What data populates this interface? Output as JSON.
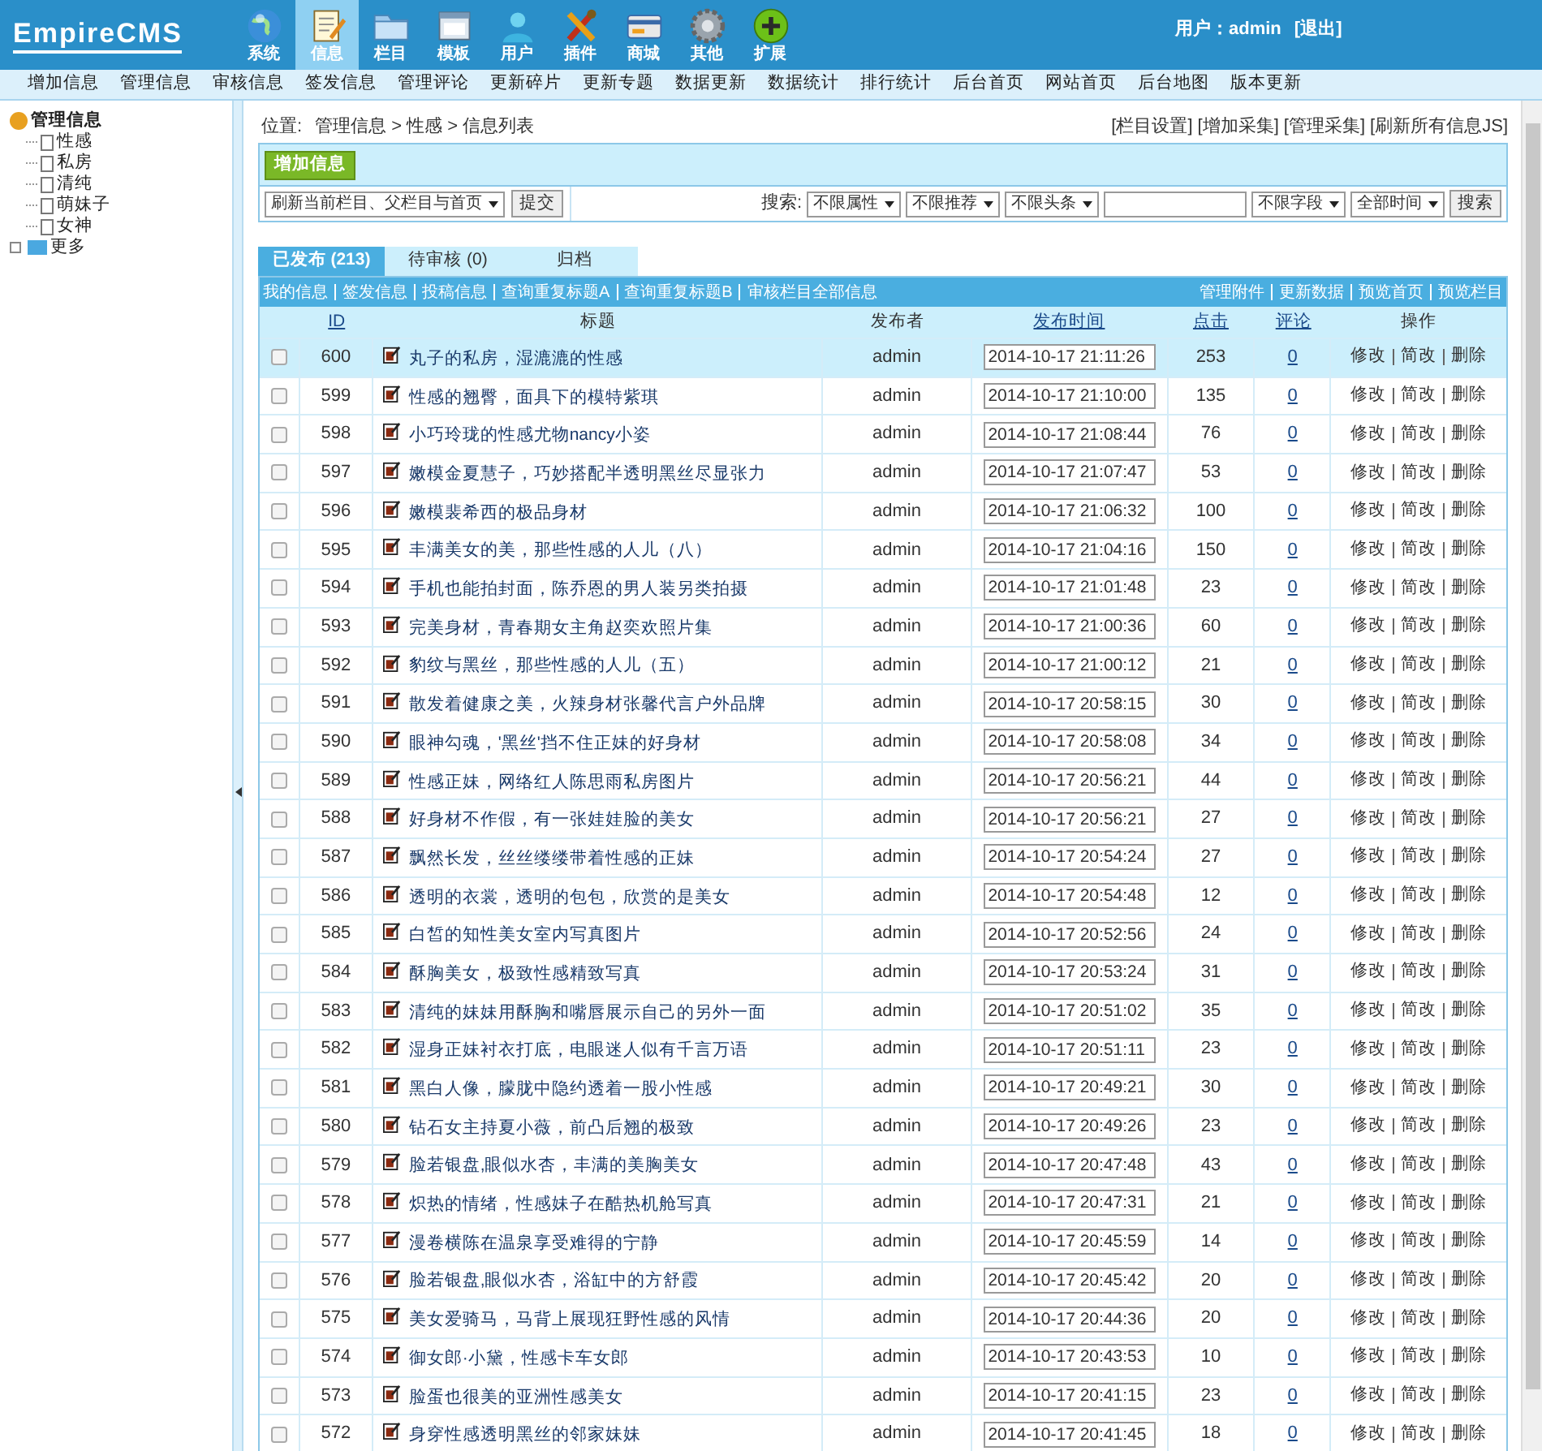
{
  "logo": {
    "text": "EmpireCMS"
  },
  "nav": [
    {
      "label": "系统",
      "selected": false
    },
    {
      "label": "信息",
      "selected": true
    },
    {
      "label": "栏目",
      "selected": false
    },
    {
      "label": "模板",
      "selected": false
    },
    {
      "label": "用户",
      "selected": false
    },
    {
      "label": "插件",
      "selected": false
    },
    {
      "label": "商城",
      "selected": false
    },
    {
      "label": "其他",
      "selected": false
    },
    {
      "label": "扩展",
      "selected": false
    }
  ],
  "user": {
    "label": "用户：",
    "name": "admin",
    "logout": "[退出]"
  },
  "subnav": [
    "增加信息",
    "管理信息",
    "审核信息",
    "签发信息",
    "管理评论",
    "更新碎片",
    "更新专题",
    "数据更新",
    "数据统计",
    "排行统计",
    "后台首页",
    "网站首页",
    "后台地图",
    "版本更新"
  ],
  "sidebar": {
    "tree": [
      {
        "label": "管理信息",
        "expanded": true,
        "children": [
          {
            "label": "性感"
          },
          {
            "label": "私房"
          },
          {
            "label": "清纯"
          },
          {
            "label": "萌妹子"
          },
          {
            "label": "女神"
          }
        ]
      },
      {
        "label": "更多",
        "expanded": false
      }
    ]
  },
  "breadcrumb": {
    "label": "位置:",
    "path": "管理信息 > 性感 > 信息列表"
  },
  "top_links": [
    "[栏目设置]",
    "[增加采集]",
    "[管理采集]",
    "[刷新所有信息JS]"
  ],
  "add_button": "增加信息",
  "refresh": {
    "select": "刷新当前栏目、父栏目与首页",
    "submit": "提交"
  },
  "search": {
    "label": "搜索:",
    "selects_before": [
      "不限属性",
      "不限推荐",
      "不限头条"
    ],
    "selects_after": [
      "不限字段",
      "全部时间"
    ],
    "button": "搜索"
  },
  "tabs": [
    {
      "label": "已发布 (213)",
      "selected": true
    },
    {
      "label": "待审核 (0)",
      "selected": false
    },
    {
      "label": "归档",
      "selected": false
    }
  ],
  "links_left": [
    "我的信息",
    "签发信息",
    "投稿信息",
    "查询重复标题A",
    "查询重复标题B",
    "审核栏目全部信息"
  ],
  "links_right": [
    "管理附件",
    "更新数据",
    "预览首页",
    "预览栏目"
  ],
  "table": {
    "columns": [
      {
        "label": "ID",
        "link": true
      },
      {
        "label": "标题",
        "link": false
      },
      {
        "label": "发布者",
        "link": false
      },
      {
        "label": "发布时间",
        "link": true
      },
      {
        "label": "点击",
        "link": true
      },
      {
        "label": "评论",
        "link": true
      },
      {
        "label": "操作",
        "link": false
      }
    ],
    "rows": [
      {
        "id": "600",
        "title": "丸子的私房，湿漉漉的性感",
        "author": "admin",
        "time": "2014-10-17 21:11:26",
        "clicks": "253",
        "comments": "0",
        "actions": [
          "修改",
          "简改",
          "删除"
        ],
        "selected": true
      },
      {
        "id": "599",
        "title": "性感的翘臀，面具下的模特紫琪",
        "author": "admin",
        "time": "2014-10-17 21:10:00",
        "clicks": "135",
        "comments": "0",
        "actions": [
          "修改",
          "简改",
          "删除"
        ],
        "selected": false
      },
      {
        "id": "598",
        "title": "小巧玲珑的性感尤物nancy小姿",
        "author": "admin",
        "time": "2014-10-17 21:08:44",
        "clicks": "76",
        "comments": "0",
        "actions": [
          "修改",
          "简改",
          "删除"
        ],
        "selected": false
      },
      {
        "id": "597",
        "title": "嫩模金夏慧子，巧妙搭配半透明黑丝尽显张力",
        "author": "admin",
        "time": "2014-10-17 21:07:47",
        "clicks": "53",
        "comments": "0",
        "actions": [
          "修改",
          "简改",
          "删除"
        ],
        "selected": false
      },
      {
        "id": "596",
        "title": "嫩模裴希西的极品身材",
        "author": "admin",
        "time": "2014-10-17 21:06:32",
        "clicks": "100",
        "comments": "0",
        "actions": [
          "修改",
          "简改",
          "删除"
        ],
        "selected": false
      },
      {
        "id": "595",
        "title": "丰满美女的美，那些性感的人儿（八）",
        "author": "admin",
        "time": "2014-10-17 21:04:16",
        "clicks": "150",
        "comments": "0",
        "actions": [
          "修改",
          "简改",
          "删除"
        ],
        "selected": false
      },
      {
        "id": "594",
        "title": "手机也能拍封面，陈乔恩的男人装另类拍摄",
        "author": "admin",
        "time": "2014-10-17 21:01:48",
        "clicks": "23",
        "comments": "0",
        "actions": [
          "修改",
          "简改",
          "删除"
        ],
        "selected": false
      },
      {
        "id": "593",
        "title": "完美身材，青春期女主角赵奕欢照片集",
        "author": "admin",
        "time": "2014-10-17 21:00:36",
        "clicks": "60",
        "comments": "0",
        "actions": [
          "修改",
          "简改",
          "删除"
        ],
        "selected": false
      },
      {
        "id": "592",
        "title": "豹纹与黑丝，那些性感的人儿（五）",
        "author": "admin",
        "time": "2014-10-17 21:00:12",
        "clicks": "21",
        "comments": "0",
        "actions": [
          "修改",
          "简改",
          "删除"
        ],
        "selected": false
      },
      {
        "id": "591",
        "title": "散发着健康之美，火辣身材张馨代言户外品牌",
        "author": "admin",
        "time": "2014-10-17 20:58:15",
        "clicks": "30",
        "comments": "0",
        "actions": [
          "修改",
          "简改",
          "删除"
        ],
        "selected": false
      },
      {
        "id": "590",
        "title": "眼神勾魂，'黑丝'挡不住正妹的好身材",
        "author": "admin",
        "time": "2014-10-17 20:58:08",
        "clicks": "34",
        "comments": "0",
        "actions": [
          "修改",
          "简改",
          "删除"
        ],
        "selected": false
      },
      {
        "id": "589",
        "title": "性感正妹，网络红人陈思雨私房图片",
        "author": "admin",
        "time": "2014-10-17 20:56:21",
        "clicks": "44",
        "comments": "0",
        "actions": [
          "修改",
          "简改",
          "删除"
        ],
        "selected": false
      },
      {
        "id": "588",
        "title": "好身材不作假，有一张娃娃脸的美女",
        "author": "admin",
        "time": "2014-10-17 20:56:21",
        "clicks": "27",
        "comments": "0",
        "actions": [
          "修改",
          "简改",
          "删除"
        ],
        "selected": false
      },
      {
        "id": "587",
        "title": "飘然长发，丝丝缕缕带着性感的正妹",
        "author": "admin",
        "time": "2014-10-17 20:54:24",
        "clicks": "27",
        "comments": "0",
        "actions": [
          "修改",
          "简改",
          "删除"
        ],
        "selected": false
      },
      {
        "id": "586",
        "title": "透明的衣裳，透明的包包，欣赏的是美女",
        "author": "admin",
        "time": "2014-10-17 20:54:48",
        "clicks": "12",
        "comments": "0",
        "actions": [
          "修改",
          "简改",
          "删除"
        ],
        "selected": false
      },
      {
        "id": "585",
        "title": "白皙的知性美女室内写真图片",
        "author": "admin",
        "time": "2014-10-17 20:52:56",
        "clicks": "24",
        "comments": "0",
        "actions": [
          "修改",
          "简改",
          "删除"
        ],
        "selected": false
      },
      {
        "id": "584",
        "title": "酥胸美女，极致性感精致写真",
        "author": "admin",
        "time": "2014-10-17 20:53:24",
        "clicks": "31",
        "comments": "0",
        "actions": [
          "修改",
          "简改",
          "删除"
        ],
        "selected": false
      },
      {
        "id": "583",
        "title": "清纯的妹妹用酥胸和嘴唇展示自己的另外一面",
        "author": "admin",
        "time": "2014-10-17 20:51:02",
        "clicks": "35",
        "comments": "0",
        "actions": [
          "修改",
          "简改",
          "删除"
        ],
        "selected": false
      },
      {
        "id": "582",
        "title": "湿身正妹衬衣打底，电眼迷人似有千言万语",
        "author": "admin",
        "time": "2014-10-17 20:51:11",
        "clicks": "23",
        "comments": "0",
        "actions": [
          "修改",
          "简改",
          "删除"
        ],
        "selected": false
      },
      {
        "id": "581",
        "title": "黑白人像，朦胧中隐约透着一股小性感",
        "author": "admin",
        "time": "2014-10-17 20:49:21",
        "clicks": "30",
        "comments": "0",
        "actions": [
          "修改",
          "简改",
          "删除"
        ],
        "selected": false
      },
      {
        "id": "580",
        "title": "钻石女主持夏小薇，前凸后翘的极致",
        "author": "admin",
        "time": "2014-10-17 20:49:26",
        "clicks": "23",
        "comments": "0",
        "actions": [
          "修改",
          "简改",
          "删除"
        ],
        "selected": false
      },
      {
        "id": "579",
        "title": "脸若银盘,眼似水杏，丰满的美胸美女",
        "author": "admin",
        "time": "2014-10-17 20:47:48",
        "clicks": "43",
        "comments": "0",
        "actions": [
          "修改",
          "简改",
          "删除"
        ],
        "selected": false
      },
      {
        "id": "578",
        "title": "炽热的情绪，性感妹子在酷热机舱写真",
        "author": "admin",
        "time": "2014-10-17 20:47:31",
        "clicks": "21",
        "comments": "0",
        "actions": [
          "修改",
          "简改",
          "删除"
        ],
        "selected": false
      },
      {
        "id": "577",
        "title": "漫卷横陈在温泉享受难得的宁静",
        "author": "admin",
        "time": "2014-10-17 20:45:59",
        "clicks": "14",
        "comments": "0",
        "actions": [
          "修改",
          "简改",
          "删除"
        ],
        "selected": false
      },
      {
        "id": "576",
        "title": "脸若银盘,眼似水杏，浴缸中的方舒霞",
        "author": "admin",
        "time": "2014-10-17 20:45:42",
        "clicks": "20",
        "comments": "0",
        "actions": [
          "修改",
          "简改",
          "删除"
        ],
        "selected": false
      },
      {
        "id": "575",
        "title": "美女爱骑马，马背上展现狂野性感的风情",
        "author": "admin",
        "time": "2014-10-17 20:44:36",
        "clicks": "20",
        "comments": "0",
        "actions": [
          "修改",
          "简改",
          "删除"
        ],
        "selected": false
      },
      {
        "id": "574",
        "title": "御女郎·小黛，性感卡车女郎",
        "author": "admin",
        "time": "2014-10-17 20:43:53",
        "clicks": "10",
        "comments": "0",
        "actions": [
          "修改",
          "简改",
          "删除"
        ],
        "selected": false
      },
      {
        "id": "573",
        "title": "脸蛋也很美的亚洲性感美女",
        "author": "admin",
        "time": "2014-10-17 20:41:15",
        "clicks": "23",
        "comments": "0",
        "actions": [
          "修改",
          "简改",
          "删除"
        ],
        "selected": false
      },
      {
        "id": "572",
        "title": "身穿性感透明黑丝的邻家妹妹",
        "author": "admin",
        "time": "2014-10-17 20:41:45",
        "clicks": "18",
        "comments": "0",
        "actions": [
          "修改",
          "简改",
          "删除"
        ],
        "selected": false
      }
    ]
  }
}
